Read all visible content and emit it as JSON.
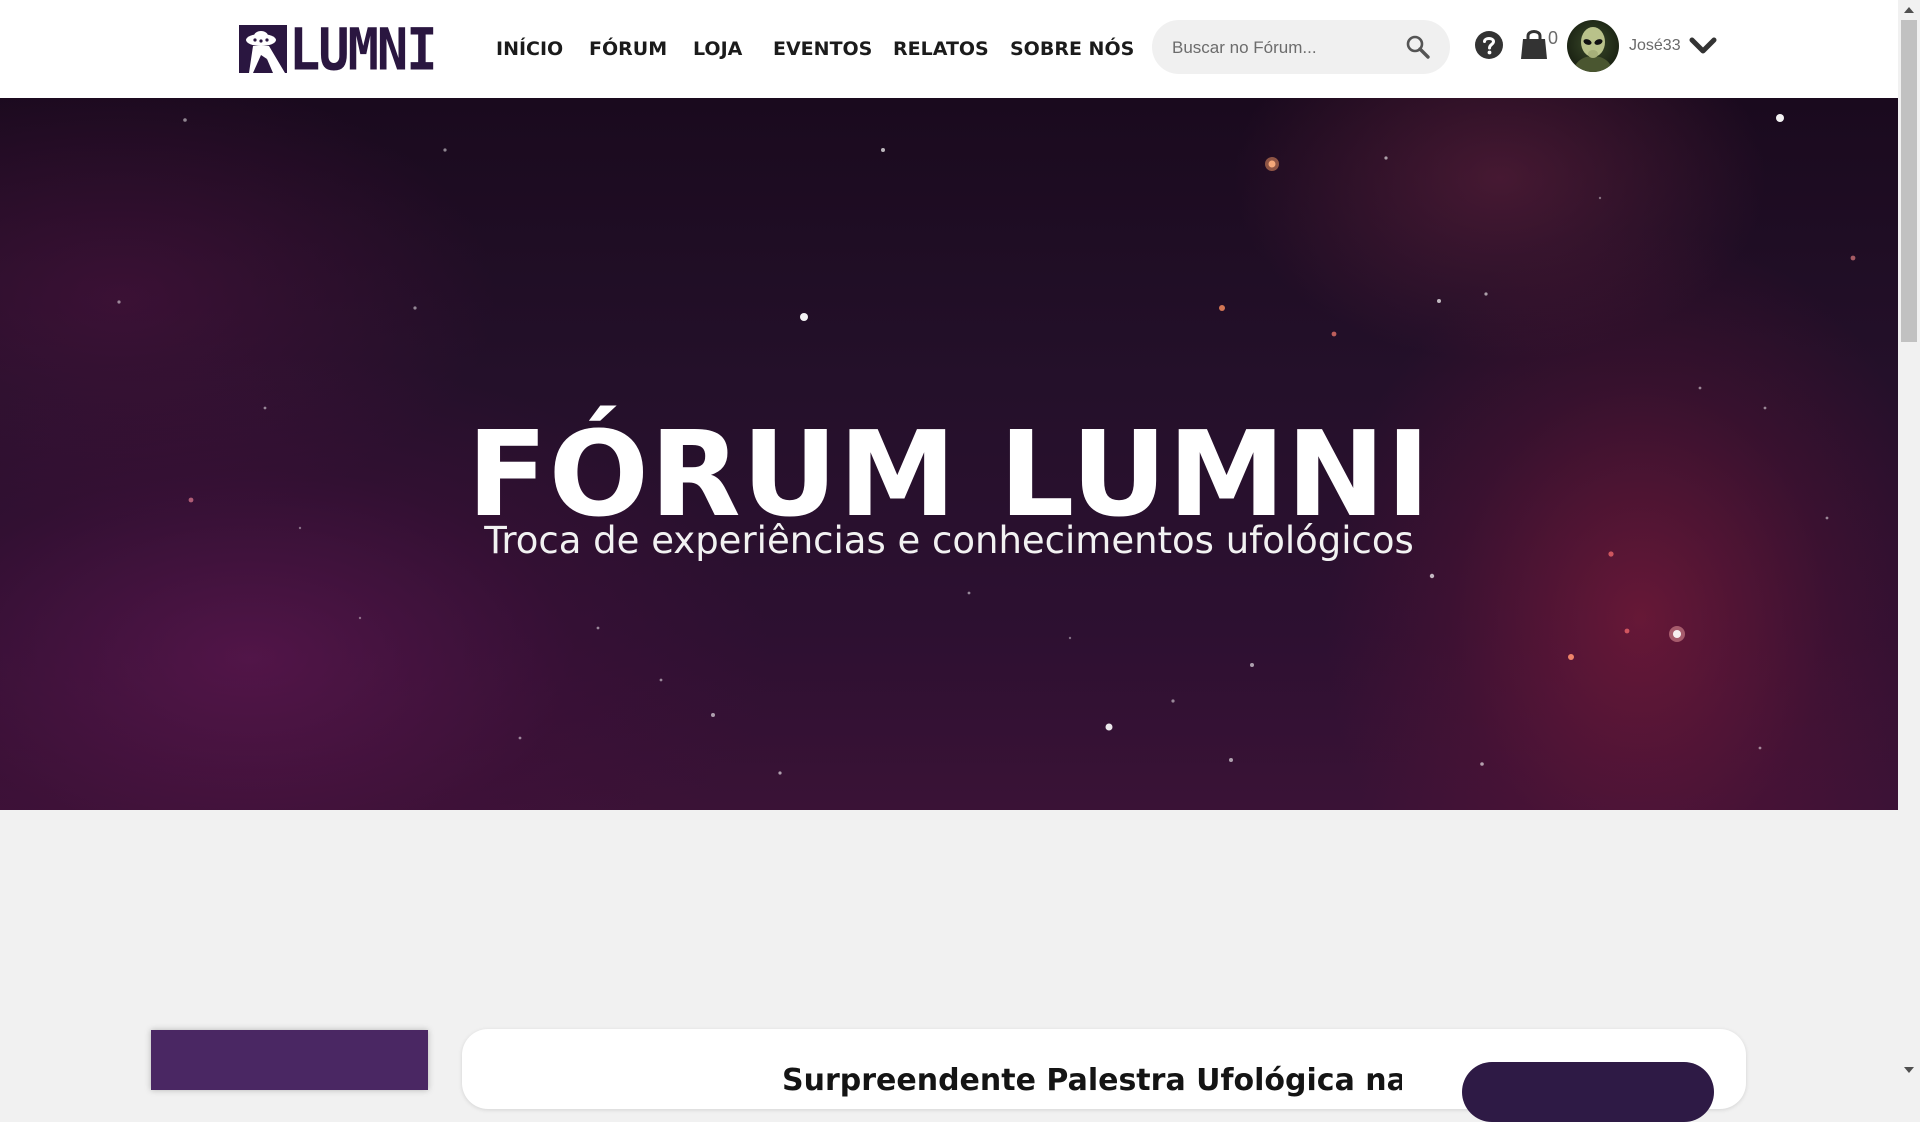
{
  "header": {
    "logo_text": "LUMNI",
    "nav": [
      {
        "label": "INÍCIO"
      },
      {
        "label": "FÓRUM"
      },
      {
        "label": "LOJA"
      },
      {
        "label": "EVENTOS"
      },
      {
        "label": "RELATOS"
      },
      {
        "label": "SOBRE NÓS"
      }
    ],
    "search": {
      "placeholder": "Buscar no Fórum...",
      "value": ""
    },
    "cart_count": "0",
    "user": {
      "name": "José33"
    },
    "icons": {
      "search": "search-icon",
      "help": "help-icon",
      "cart": "shopping-bag-icon",
      "menu": "chevron-down-icon"
    }
  },
  "hero": {
    "title": "FÓRUM LUMNI",
    "subtitle": "Troca de experiências e conhecimentos ufológicos"
  },
  "event": {
    "title": "Surpreendente Palestra Ufológica na"
  },
  "colors": {
    "brand": "#2a1640",
    "accent": "#4a2763",
    "button": "#2e1a45",
    "page_background": "#f1f1f1"
  }
}
